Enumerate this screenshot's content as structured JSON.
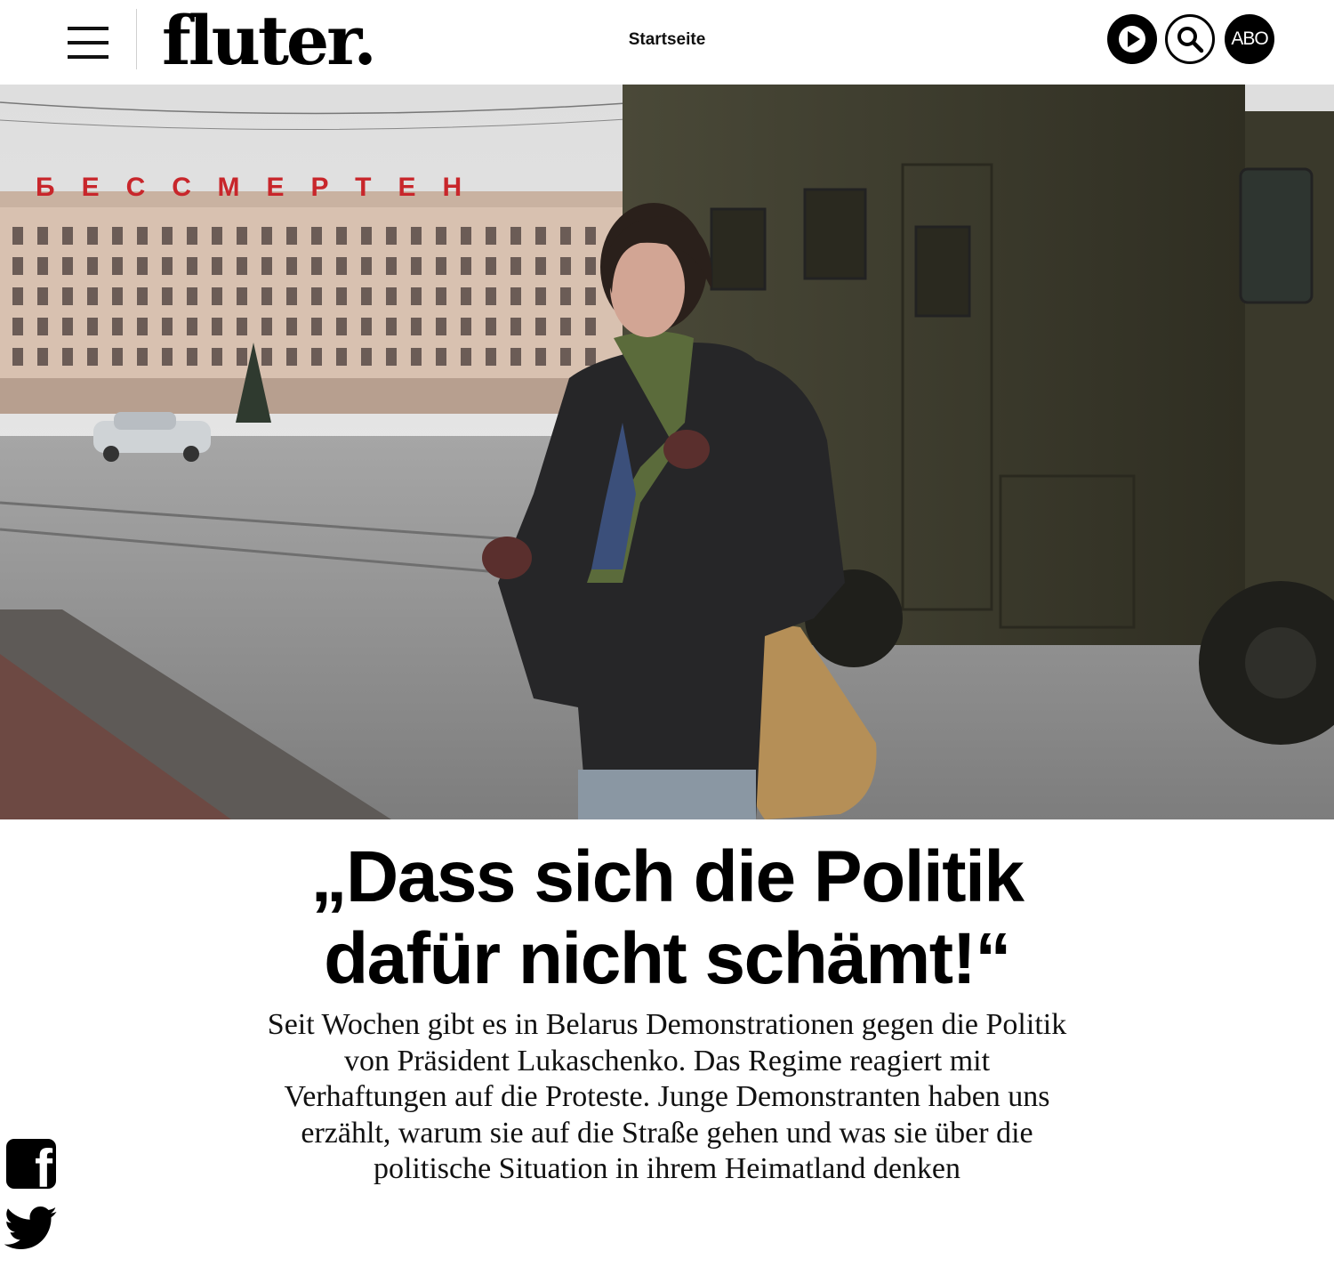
{
  "header": {
    "logo": "fluter.",
    "nav_home": "Startseite",
    "abo_label": "ABO"
  },
  "icons": {
    "menu": "hamburger-menu-icon",
    "play": "play-icon",
    "search": "search-icon",
    "facebook": "facebook-icon",
    "twitter": "twitter-icon"
  },
  "hero": {
    "sign_text": "БЕССМЕРТЕН"
  },
  "article": {
    "headline_line1": "„Dass sich die Politik",
    "headline_line2": "dafür nicht schämt!“",
    "teaser_lines": [
      "Seit Wochen gibt es in Belarus Demonstrationen gegen die Politik",
      "von Präsident Lukaschenko. Das Regime reagiert mit",
      "Verhaftungen auf die Proteste. Junge Demonstranten haben uns",
      "erzählt, warum sie auf die Straße gehen und was sie über die",
      "politische Situation in ihrem Heimatland denken"
    ]
  },
  "colors": {
    "truck": "#3b3a2b",
    "sign_red": "#c8262b",
    "building": "#d9c2b2",
    "road": "#8e8e8e",
    "sky": "#e4e4e4"
  }
}
